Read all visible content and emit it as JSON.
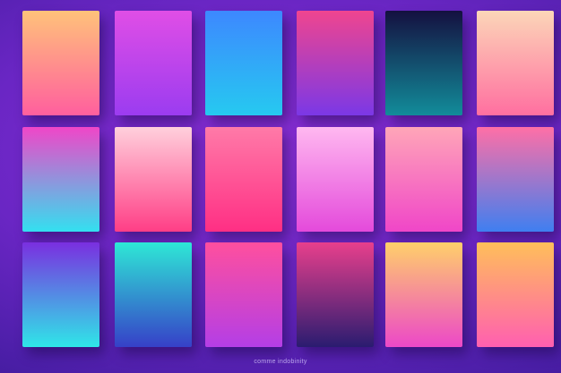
{
  "caption": "comme indobinity",
  "swatches": [
    {
      "name": "swatch-peach-pink",
      "colors": [
        "#ffc27a",
        "#ff5f9e"
      ]
    },
    {
      "name": "swatch-magenta-violet",
      "colors": [
        "#e04ee6",
        "#9b3cf0"
      ]
    },
    {
      "name": "swatch-blue-cyan",
      "colors": [
        "#3d88ff",
        "#26c9f0"
      ]
    },
    {
      "name": "swatch-pink-purple",
      "colors": [
        "#f0458f",
        "#7b38e6"
      ]
    },
    {
      "name": "swatch-navy-teal",
      "colors": [
        "#141040",
        "#128c9a"
      ]
    },
    {
      "name": "swatch-cream-pink",
      "colors": [
        "#fcd6b8",
        "#ff6fa0"
      ]
    },
    {
      "name": "swatch-magenta-cyan",
      "colors": [
        "#f046c8",
        "#33e0f0"
      ]
    },
    {
      "name": "swatch-blush-pink",
      "colors": [
        "#ffd0dc",
        "#ff3e86"
      ]
    },
    {
      "name": "swatch-pink-rose",
      "colors": [
        "#ff7aa8",
        "#ff2f84"
      ]
    },
    {
      "name": "swatch-lilac-pink",
      "colors": [
        "#ffb8f0",
        "#e44adb"
      ]
    },
    {
      "name": "swatch-peach-magenta",
      "colors": [
        "#ffa6b8",
        "#f046c8"
      ]
    },
    {
      "name": "swatch-violet-blue",
      "colors": [
        "#ff6fa6",
        "#3f7ff0"
      ]
    },
    {
      "name": "swatch-violet-aqua",
      "colors": [
        "#7a2fe0",
        "#2fe6e8"
      ]
    },
    {
      "name": "swatch-teal-indigo",
      "colors": [
        "#2ee8d6",
        "#3640c8"
      ]
    },
    {
      "name": "swatch-hotpink-violet",
      "colors": [
        "#ff4f9e",
        "#b43ee6"
      ]
    },
    {
      "name": "swatch-rose-navy",
      "colors": [
        "#e83f8c",
        "#2a1c70"
      ]
    },
    {
      "name": "swatch-gold-magenta",
      "colors": [
        "#ffd06a",
        "#ec48c8"
      ]
    },
    {
      "name": "swatch-amber-pink",
      "colors": [
        "#ffbf5a",
        "#ff5fb0"
      ]
    }
  ]
}
